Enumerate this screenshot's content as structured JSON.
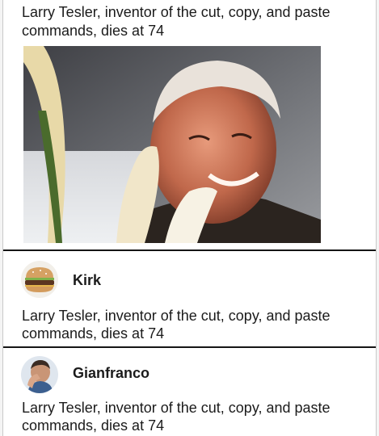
{
  "post": {
    "headline": "Larry Tesler, inventor of the cut, copy, and paste commands, dies at 74",
    "photo_icon": "portrait-photo"
  },
  "comments": [
    {
      "username": "Kirk",
      "avatar_icon": "hamburger-avatar",
      "text": "Larry Tesler, inventor of the cut, copy, and paste commands, dies at 74"
    },
    {
      "username": "Gianfranco",
      "avatar_icon": "facepalm-avatar",
      "text": "Larry Tesler, inventor of the cut, copy, and paste commands, dies at 74"
    }
  ],
  "colors": {
    "text": "#1b1b1b",
    "divider": "#151515",
    "background": "#ffffff"
  }
}
